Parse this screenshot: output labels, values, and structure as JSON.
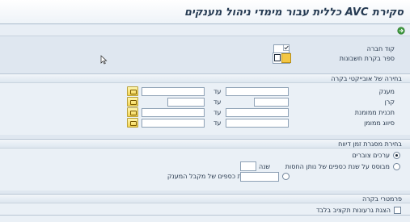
{
  "title": "סקירת AVC כללית עבור מימדי ניהול מענקים",
  "company_code": {
    "label": "קוד חברה",
    "value": ""
  },
  "fiscal_year_variant": {
    "label": "ספר בקרת חשבונות",
    "value": ""
  },
  "objects_section": {
    "header": "בחירה של אובייקטי בקרה",
    "to_label": "עד",
    "rows": [
      {
        "label": "מענק",
        "from": "",
        "to": ""
      },
      {
        "label": "קרן",
        "from": "",
        "to": ""
      },
      {
        "label": "תכנית ממומנת",
        "from": "",
        "to": ""
      },
      {
        "label": "סיווג ממומן",
        "from": "",
        "to": ""
      }
    ]
  },
  "period_section": {
    "header": "בחירת מסגרת זמן דיווח",
    "option_cumulative": "ערכים צוברים",
    "option_sponsor_year": "מבוסס על שנת כספים של נותן החסות",
    "option_recipient_year": "מבוסס על שנת כספים של מקבל המענק",
    "year_label": "שנה",
    "sponsor_year_value": "",
    "recipient_year_value": ""
  },
  "control_section": {
    "header": "פרמטרי בקרה",
    "show_budget_groups": "הצגת גרעונות תקציב בלבד"
  },
  "colors": {
    "background": "#dfe7f0",
    "selection_button": "#f4d451",
    "title_text": "#253a52"
  }
}
